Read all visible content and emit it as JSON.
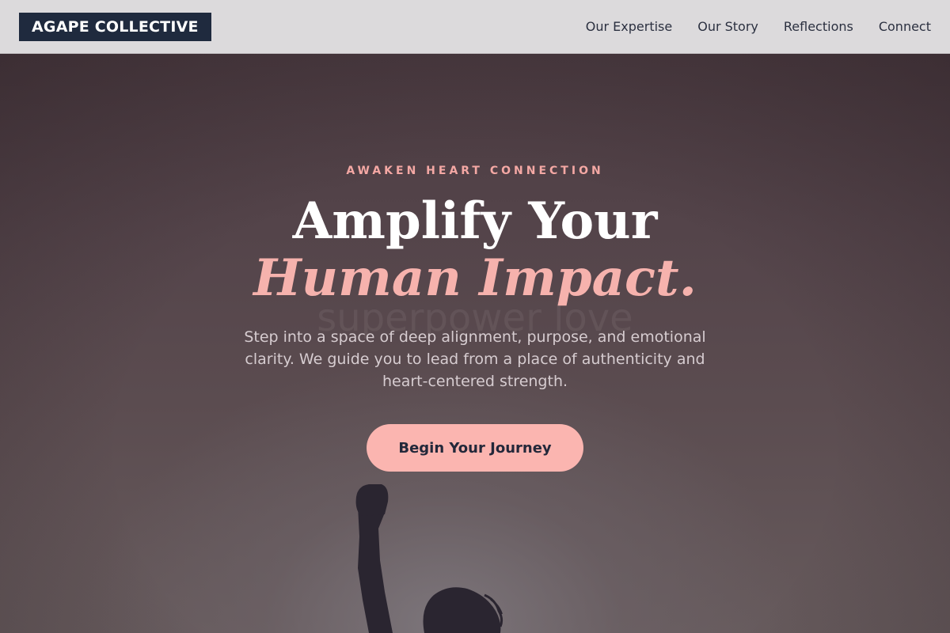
{
  "brand": {
    "name": "AGAPE COLLECTIVE"
  },
  "nav": {
    "items": [
      {
        "label": "Our Expertise"
      },
      {
        "label": "Our Story"
      },
      {
        "label": "Reflections"
      },
      {
        "label": "Connect"
      }
    ]
  },
  "hero": {
    "eyebrow": "AWAKEN HEART CONNECTION",
    "title_line1": "Amplify Your",
    "title_line2": "Human Impact.",
    "watermark": "superpower love",
    "subtitle": "Step into a space of deep alignment, purpose, and emotional clarity. We guide you to lead from a place of authenticity and heart-centered strength.",
    "cta_label": "Begin Your Journey"
  },
  "colors": {
    "nav_bg": "#dcdadc",
    "logo_bg": "#1f2a3e",
    "accent_pink": "#fbb5b0",
    "title_pink": "#f6b2ad",
    "eyebrow_pink": "#f4a8a4",
    "text_dark": "#23283a"
  }
}
